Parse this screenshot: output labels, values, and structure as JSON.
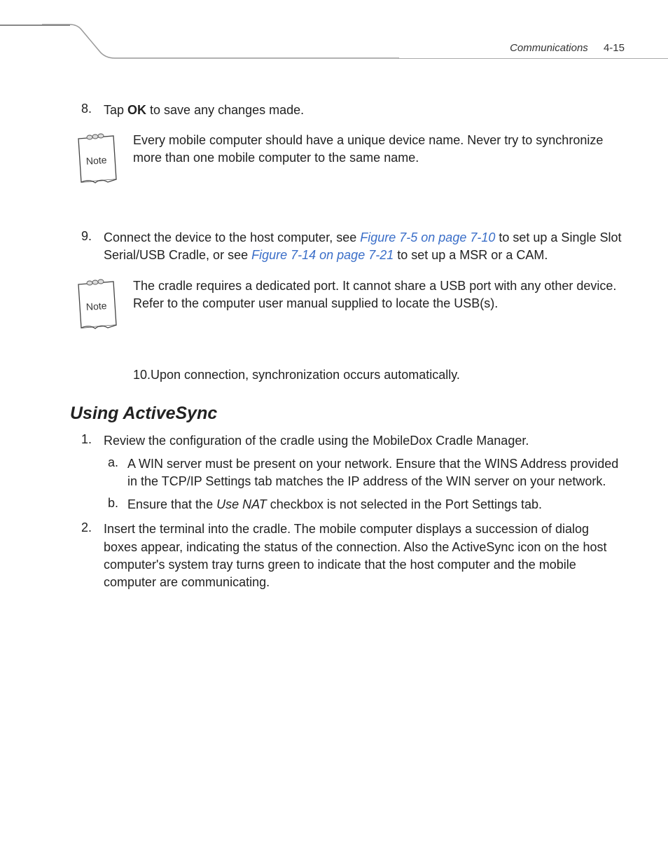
{
  "header": {
    "section": "Communications",
    "page": "4-15"
  },
  "step8": {
    "number": "8.",
    "pre": "Tap ",
    "bold": "OK",
    "post": " to save any changes made."
  },
  "note1": {
    "label": "Note",
    "text": "Every mobile computer should have a unique device name. Never try to synchronize more than one mobile computer to the same name."
  },
  "step9": {
    "number": "9.",
    "pre": "Connect the device to the host computer, see ",
    "link1": "Figure 7-5 on page 7-10",
    "mid": " to set up a Single Slot Serial/USB Cradle, or see ",
    "link2": "Figure 7-14 on page 7-21",
    "post": " to set up a MSR or a CAM."
  },
  "note2": {
    "label": "Note",
    "text": "The cradle requires a dedicated port. It cannot share a USB port with any other device. Refer to the computer user manual supplied to locate the USB(s)."
  },
  "step10": {
    "text": "10.Upon connection, synchronization occurs automatically."
  },
  "heading": "Using ActiveSync",
  "as_step1": {
    "number": "1.",
    "text": "Review the configuration of the cradle using the MobileDox Cradle Manager."
  },
  "as_step1a": {
    "letter": "a.",
    "text": "A WIN server must be present on your network. Ensure that the WINS Address provided in the TCP/IP Settings tab matches the IP address of the WIN server on your network."
  },
  "as_step1b": {
    "letter": "b.",
    "pre": "Ensure that the ",
    "italic": "Use NAT",
    "post": " checkbox is not selected in the Port Settings tab."
  },
  "as_step2": {
    "number": "2.",
    "text": "Insert the terminal into the cradle. The mobile computer displays a succession of dialog boxes appear, indicating the status of the connection. Also the ActiveSync icon on the host computer's system tray turns green to indicate that the host computer and the mobile computer are communicating."
  }
}
